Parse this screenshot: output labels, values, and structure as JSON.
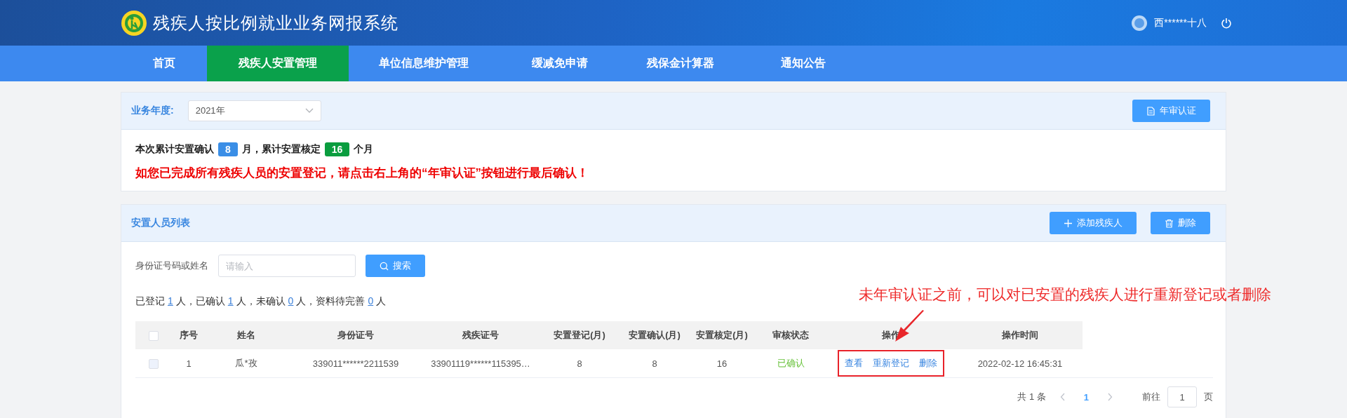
{
  "header": {
    "title": "残疾人按比例就业业务网报系统",
    "user": "西******十八"
  },
  "nav": [
    {
      "label": "首页",
      "selected": false
    },
    {
      "label": "残疾人安置管理",
      "selected": true
    },
    {
      "label": "单位信息维护管理",
      "selected": false
    },
    {
      "label": "缓减免申请",
      "selected": false
    },
    {
      "label": "残保金计算器",
      "selected": false
    },
    {
      "label": "通知公告",
      "selected": false
    }
  ],
  "year_card": {
    "label": "业务年度:",
    "year": "2021年",
    "button": "年审认证",
    "summary": {
      "prefix": "本次累计安置确认",
      "confirmed": "8",
      "middle": "月，累计安置核定",
      "approved": "16",
      "suffix": "个月"
    },
    "notice": "如您已完成所有残疾人员的安置登记，请点击右上角的“年审认证”按钮进行最后确认！"
  },
  "list_card": {
    "title": "安置人员列表",
    "buttons": [
      {
        "label": "添加残疾人",
        "kind": "add"
      },
      {
        "label": "删除",
        "kind": "delete"
      }
    ],
    "search": {
      "label": "身份证号码或姓名",
      "placeholder": "请输入",
      "button": "搜索"
    },
    "stats": [
      {
        "kind": "text",
        "text": "已登记"
      },
      {
        "kind": "link",
        "text": "1"
      },
      {
        "kind": "text",
        "text": "人，已确认"
      },
      {
        "kind": "link",
        "text": "1"
      },
      {
        "kind": "text",
        "text": "人，未确认"
      },
      {
        "kind": "link",
        "text": "0"
      },
      {
        "kind": "text",
        "text": "人，资料待完善"
      },
      {
        "kind": "link",
        "text": "0"
      },
      {
        "kind": "text",
        "text": "人"
      }
    ],
    "table": {
      "columns": [
        "序号",
        "姓名",
        "身份证号",
        "残疾证号",
        "安置登记(月)",
        "安置确认(月)",
        "安置核定(月)",
        "审核状态",
        "操作",
        "操作时间"
      ],
      "header_checked": false,
      "rows": [
        {
          "checked": false,
          "disabled": true,
          "cells": [
            "1",
            "瓜*孜",
            "339011******2211539",
            "33901119******115395…",
            "8",
            "8",
            "16"
          ],
          "status": "已确认",
          "color": "#67c23a",
          "actions": [
            "查看",
            "重新登记",
            "删除"
          ],
          "time": "2022-02-12 16:45:31"
        }
      ]
    },
    "pagination": {
      "total": "共 1 条",
      "pages": [
        {
          "label": "1",
          "selected": true
        }
      ],
      "goto_label": "前往",
      "goto_value": "1",
      "goto_suffix": "页"
    }
  },
  "annotation": "未年审认证之前，可以对已安置的残疾人进行重新登记或者删除"
}
